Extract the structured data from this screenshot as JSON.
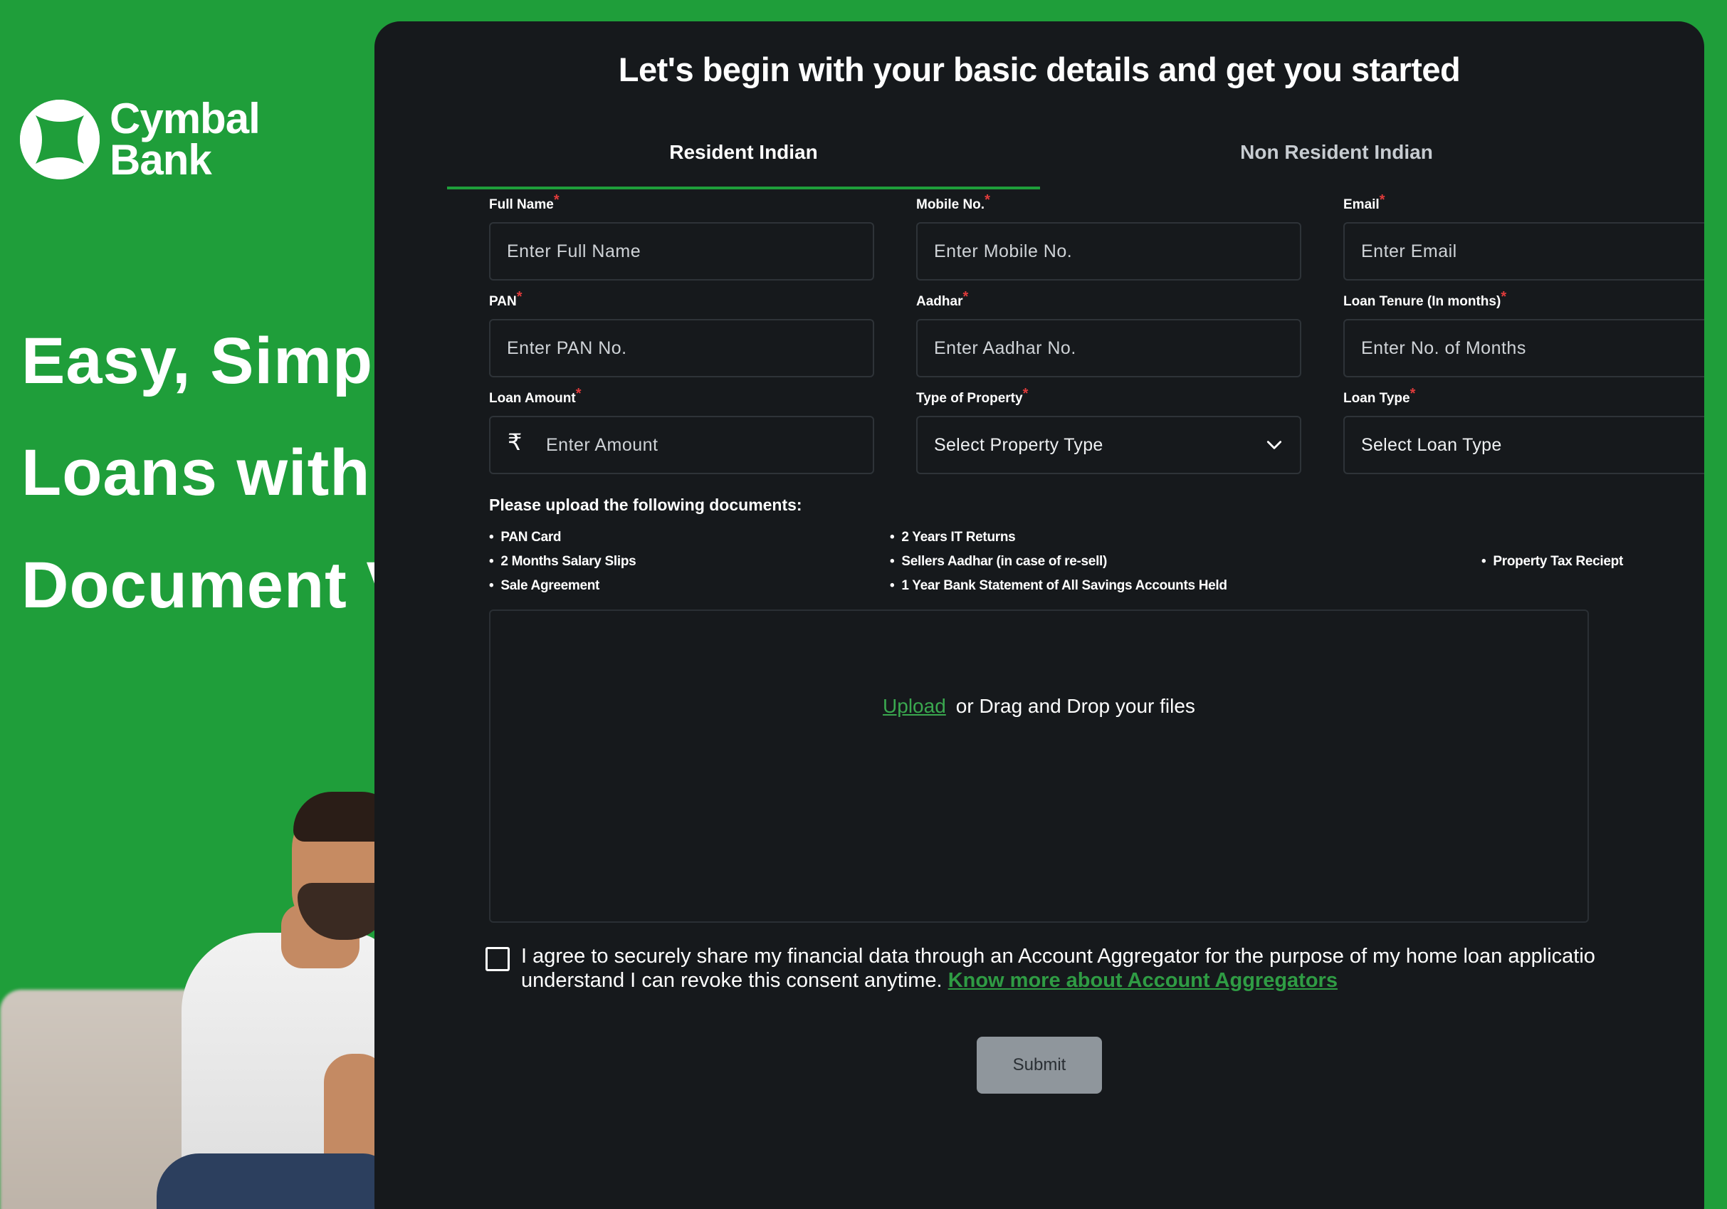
{
  "brand": {
    "logo_line1": "Cymbal",
    "logo_line2": "Bank",
    "accent_color": "#1f9e3a",
    "logo_icon": "cymbal-star-icon"
  },
  "hero": {
    "line1": "Easy, Simple",
    "line2": "Loans with I",
    "line3": "Document V"
  },
  "form": {
    "title": "Let's begin with your basic details and get you started",
    "tabs": [
      {
        "label": "Resident Indian",
        "active": true
      },
      {
        "label": "Non Resident Indian",
        "active": false
      }
    ],
    "fields": {
      "full_name": {
        "label": "Full Name",
        "required": "*",
        "placeholder": "Enter Full Name",
        "value": ""
      },
      "mobile": {
        "label": "Mobile No.",
        "required": "*",
        "placeholder": "Enter Mobile No.",
        "value": ""
      },
      "email": {
        "label": "Email",
        "required": "*",
        "placeholder": "Enter Email",
        "value": ""
      },
      "pan": {
        "label": "PAN",
        "required": "*",
        "placeholder": "Enter PAN No.",
        "value": ""
      },
      "aadhar": {
        "label": "Aadhar",
        "required": "*",
        "placeholder": "Enter Aadhar No.",
        "value": ""
      },
      "loan_tenure": {
        "label": "Loan Tenure (In months)",
        "required": "*",
        "placeholder": "Enter No. of Months",
        "value": ""
      },
      "loan_amount": {
        "label": "Loan Amount",
        "required": "*",
        "placeholder": "Enter Amount",
        "value": "",
        "currency_symbol": "₹"
      },
      "property_type": {
        "label": "Type of Property",
        "required": "*",
        "selected": "Select Property Type"
      },
      "loan_type": {
        "label": "Loan Type",
        "required": "*",
        "selected": "Select Loan Type"
      }
    },
    "documents": {
      "title": "Please upload the following documents:",
      "items": [
        "PAN Card",
        "2 Months Salary Slips",
        "Sale Agreement",
        "2 Years IT Returns",
        "Sellers Aadhar (in case of re-sell)",
        "1 Year Bank Statement of All Savings Accounts Held",
        "Property Tax Reciept"
      ]
    },
    "upload": {
      "link_label": "Upload",
      "text": "or Drag and Drop your files"
    },
    "consent": {
      "checked": false,
      "text_line1": "I agree to securely share my financial data through an Account Aggregator for the purpose of my home loan applicatio",
      "text_line2": "understand I can revoke this consent anytime.",
      "link_label": "Know more about Account Aggregators"
    },
    "submit_label": "Submit"
  }
}
